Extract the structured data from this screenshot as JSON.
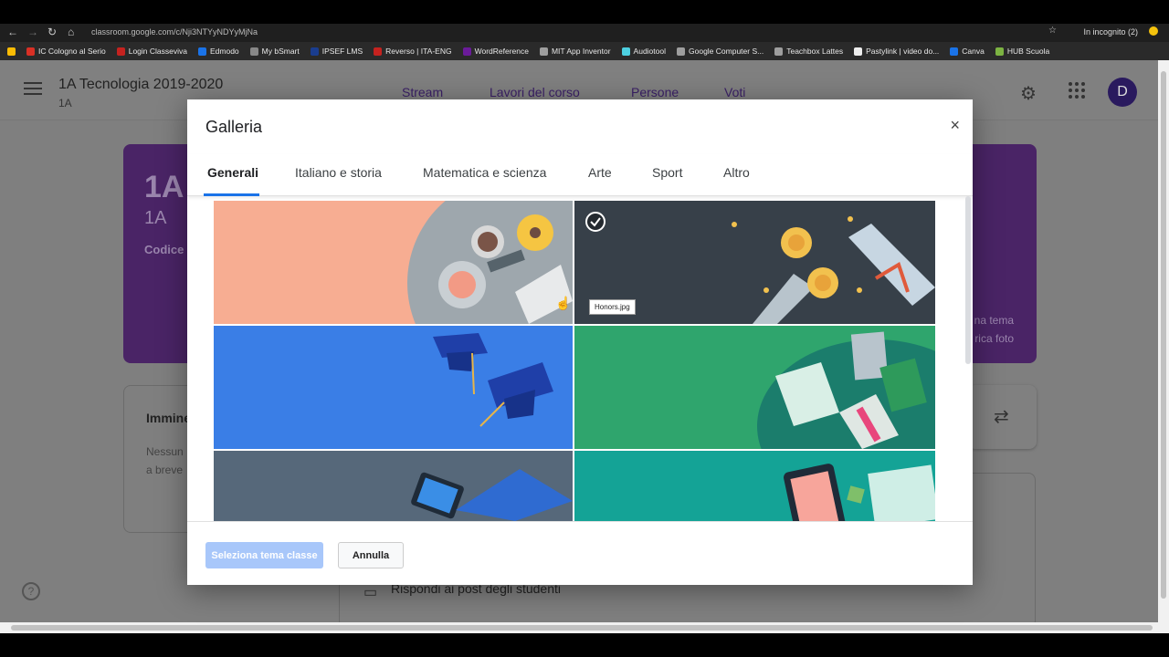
{
  "browser": {
    "url": "classroom.google.com/c/Nji3NTYyNDYyMjNa",
    "incognito_label": "In incognito (2)",
    "bookmarks": [
      {
        "label": "IC Cologno al Serio",
        "color": "#d93025"
      },
      {
        "label": "Login Classeviva",
        "color": "#c5221f"
      },
      {
        "label": "Edmodo",
        "color": "#1a73e8"
      },
      {
        "label": "My bSmart",
        "color": "#888888"
      },
      {
        "label": "IPSEF LMS",
        "color": "#1a3d8f"
      },
      {
        "label": "Reverso | ITA-ENG",
        "color": "#c5221f"
      },
      {
        "label": "WordReference",
        "color": "#6a1b9a"
      },
      {
        "label": "MIT App Inventor",
        "color": "#9e9e9e"
      },
      {
        "label": "Audiotool",
        "color": "#4dd0e1"
      },
      {
        "label": "Google Computer S...",
        "color": "#9e9e9e"
      },
      {
        "label": "Teachbox Lattes",
        "color": "#9e9e9e"
      },
      {
        "label": "Pastylink | video do...",
        "color": "#eeeeee"
      },
      {
        "label": "Canva",
        "color": "#1a73e8"
      },
      {
        "label": "HUB Scuola",
        "color": "#7cb342"
      }
    ]
  },
  "classroom": {
    "class_title": "1A Tecnologia 2019-2020",
    "class_section": "1A",
    "nav_tabs": [
      "Stream",
      "Lavori del corso",
      "Persone",
      "Voti"
    ],
    "avatar_letter": "D",
    "banner_title": "1A",
    "banner_subtitle": "1A",
    "banner_code_label": "Codice",
    "banner_action_1": "na tema",
    "banner_action_2": "rica foto",
    "upcoming_title": "Immine",
    "upcoming_text_1": "Nessun",
    "upcoming_text_2": "a breve",
    "reply_text": "Rispondi ai post degli studenti"
  },
  "dialog": {
    "title": "Galleria",
    "close_symbol": "×",
    "tabs": [
      "Generali",
      "Italiano e storia",
      "Matematica e scienza",
      "Arte",
      "Sport",
      "Altro"
    ],
    "active_tab": "Generali",
    "tooltip": "Honors.jpg",
    "select_button": "Seleziona tema classe",
    "cancel_button": "Annulla",
    "selected_tile": "Honors.jpg"
  },
  "colors": {
    "accent": "#1a73e8",
    "tile_coffee_bg": "#f7ad92",
    "tile_honors_bg": "#374049",
    "tile_grad_bg": "#3a7ee6",
    "tile_books_bg": "#2fa56d",
    "tile_laptop_bg": "#56687a",
    "tile_tablet_bg": "#14a396"
  }
}
